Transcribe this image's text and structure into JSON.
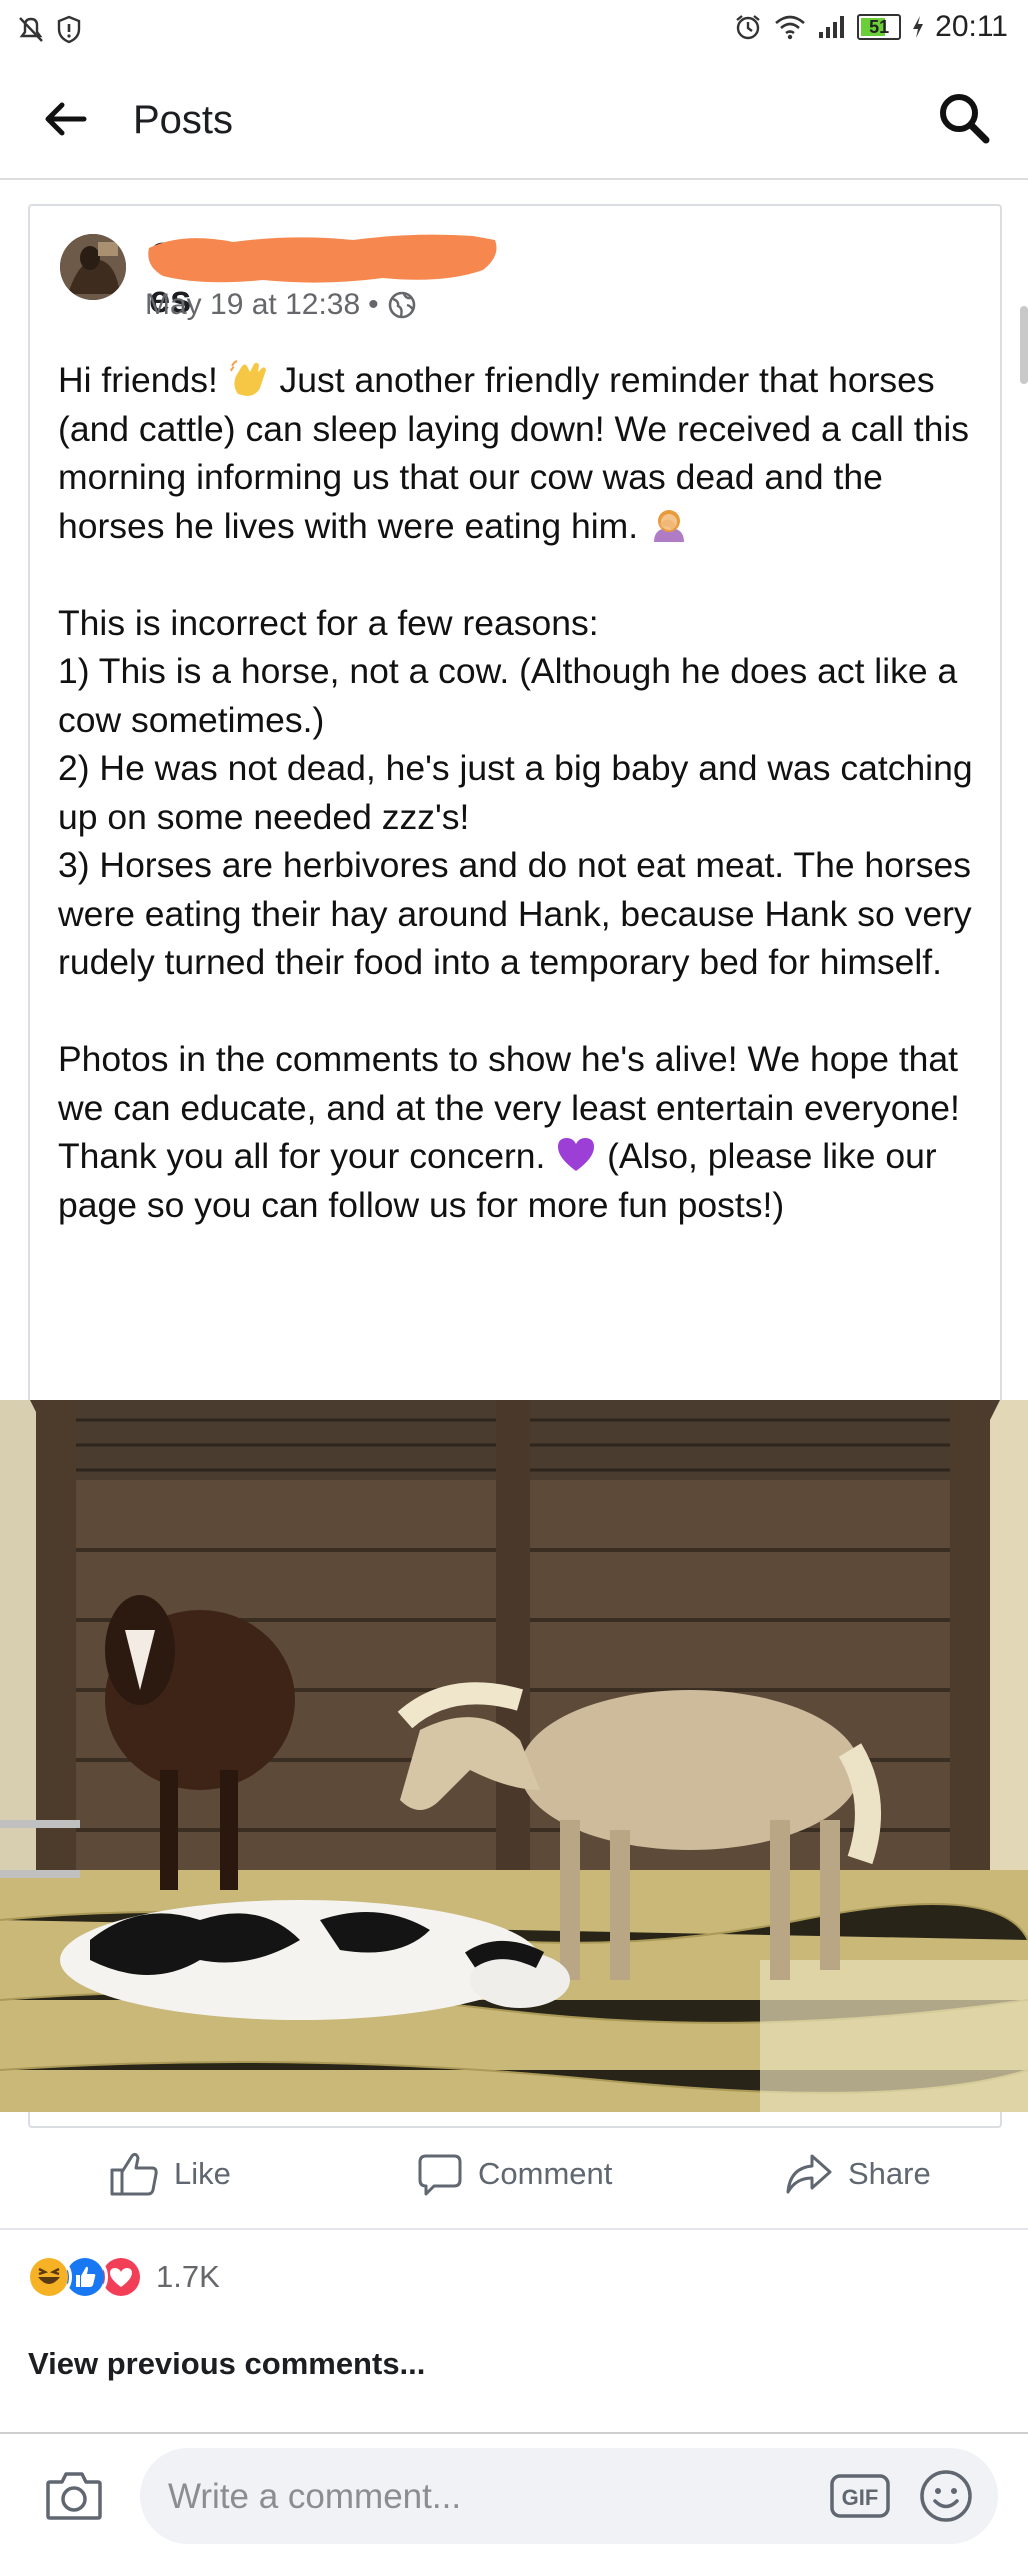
{
  "status_bar": {
    "time": "20:11",
    "battery": "51"
  },
  "header": {
    "title": "Posts"
  },
  "post": {
    "author_visible": "es",
    "timestamp": "May 19 at 12:38",
    "meta_separator": "•",
    "paragraphs": [
      [
        "Hi friends! ",
        " Just another friendly reminder that horses (and cattle) can sleep laying down! We received a call this morning informing us that our cow was dead and the horses he lives with were eating him. "
      ],
      "This is incorrect for a few reasons:\n1) This is a horse, not a cow. (Although he does act like a cow sometimes.)\n2) He was not dead, he's just a big baby and was catching up on some needed zzz's!\n3) Horses are herbivores and do not eat meat.  The horses were eating their hay around Hank, because Hank so very rudely turned their food into a temporary bed for himself.",
      [
        "Photos in the comments to show he's alive! We hope that we can educate, and at the very least entertain everyone!  Thank you all for your concern. ",
        "  (Also, please like our page so you can follow us for more fun posts!)"
      ]
    ]
  },
  "actions": {
    "like": "Like",
    "comment": "Comment",
    "share": "Share"
  },
  "reactions": {
    "count": "1.7K",
    "icons": [
      "haha",
      "like",
      "love"
    ]
  },
  "comments": {
    "view_previous": "View previous comments...",
    "placeholder": "Write a comment..."
  },
  "colors": {
    "like_blue": "#1877f2",
    "love_red": "#f33e58",
    "haha_yellow": "#f7b125",
    "redaction_orange": "#f5874f"
  }
}
